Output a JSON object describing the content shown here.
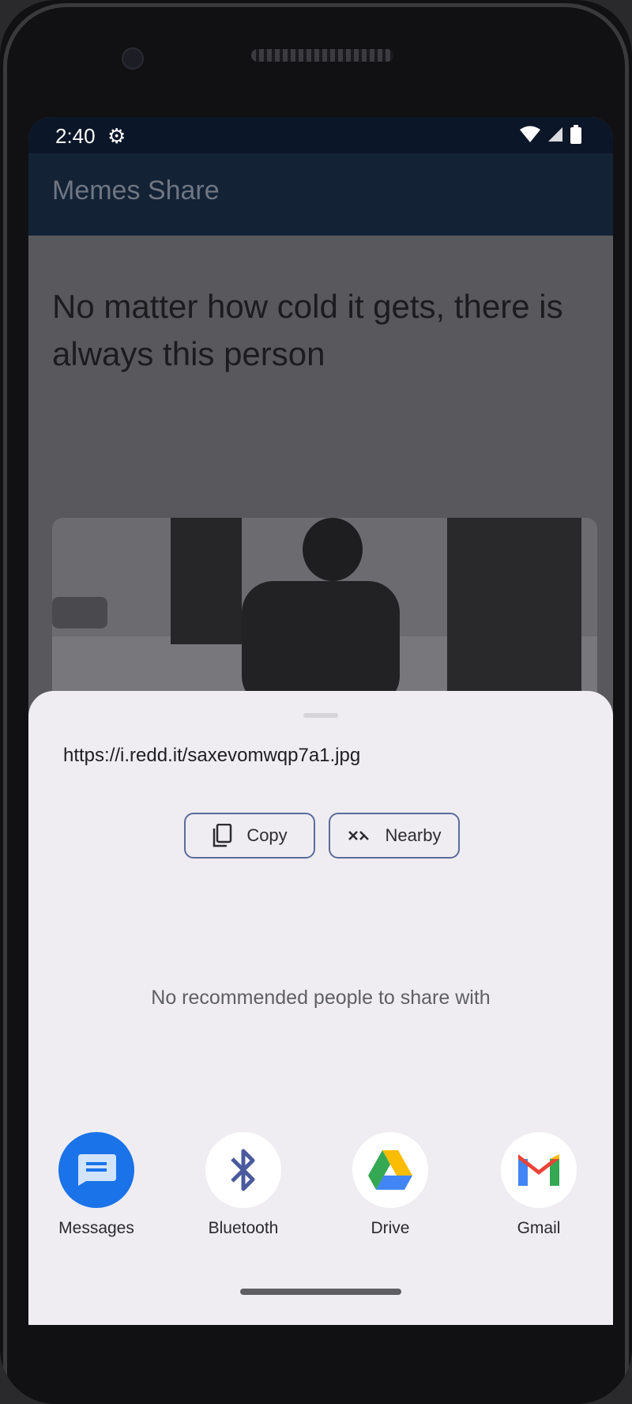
{
  "status_bar": {
    "time": "2:40"
  },
  "app_bar": {
    "title": "Memes Share"
  },
  "meme": {
    "title": "No matter how cold it gets, there is always this person"
  },
  "share_sheet": {
    "url": "https://i.redd.it/saxevomwqp7a1.jpg",
    "copy_label": "Copy",
    "nearby_label": "Nearby",
    "no_people_text": "No recommended people to share with",
    "apps": [
      {
        "label": "Messages",
        "icon": "messages-icon",
        "color": "#1a73e8"
      },
      {
        "label": "Bluetooth",
        "icon": "bluetooth-icon",
        "color": "#4a5a9c"
      },
      {
        "label": "Drive",
        "icon": "drive-icon",
        "color": "#34a853"
      },
      {
        "label": "Gmail",
        "icon": "gmail-icon",
        "color": "#ea4335"
      }
    ]
  }
}
